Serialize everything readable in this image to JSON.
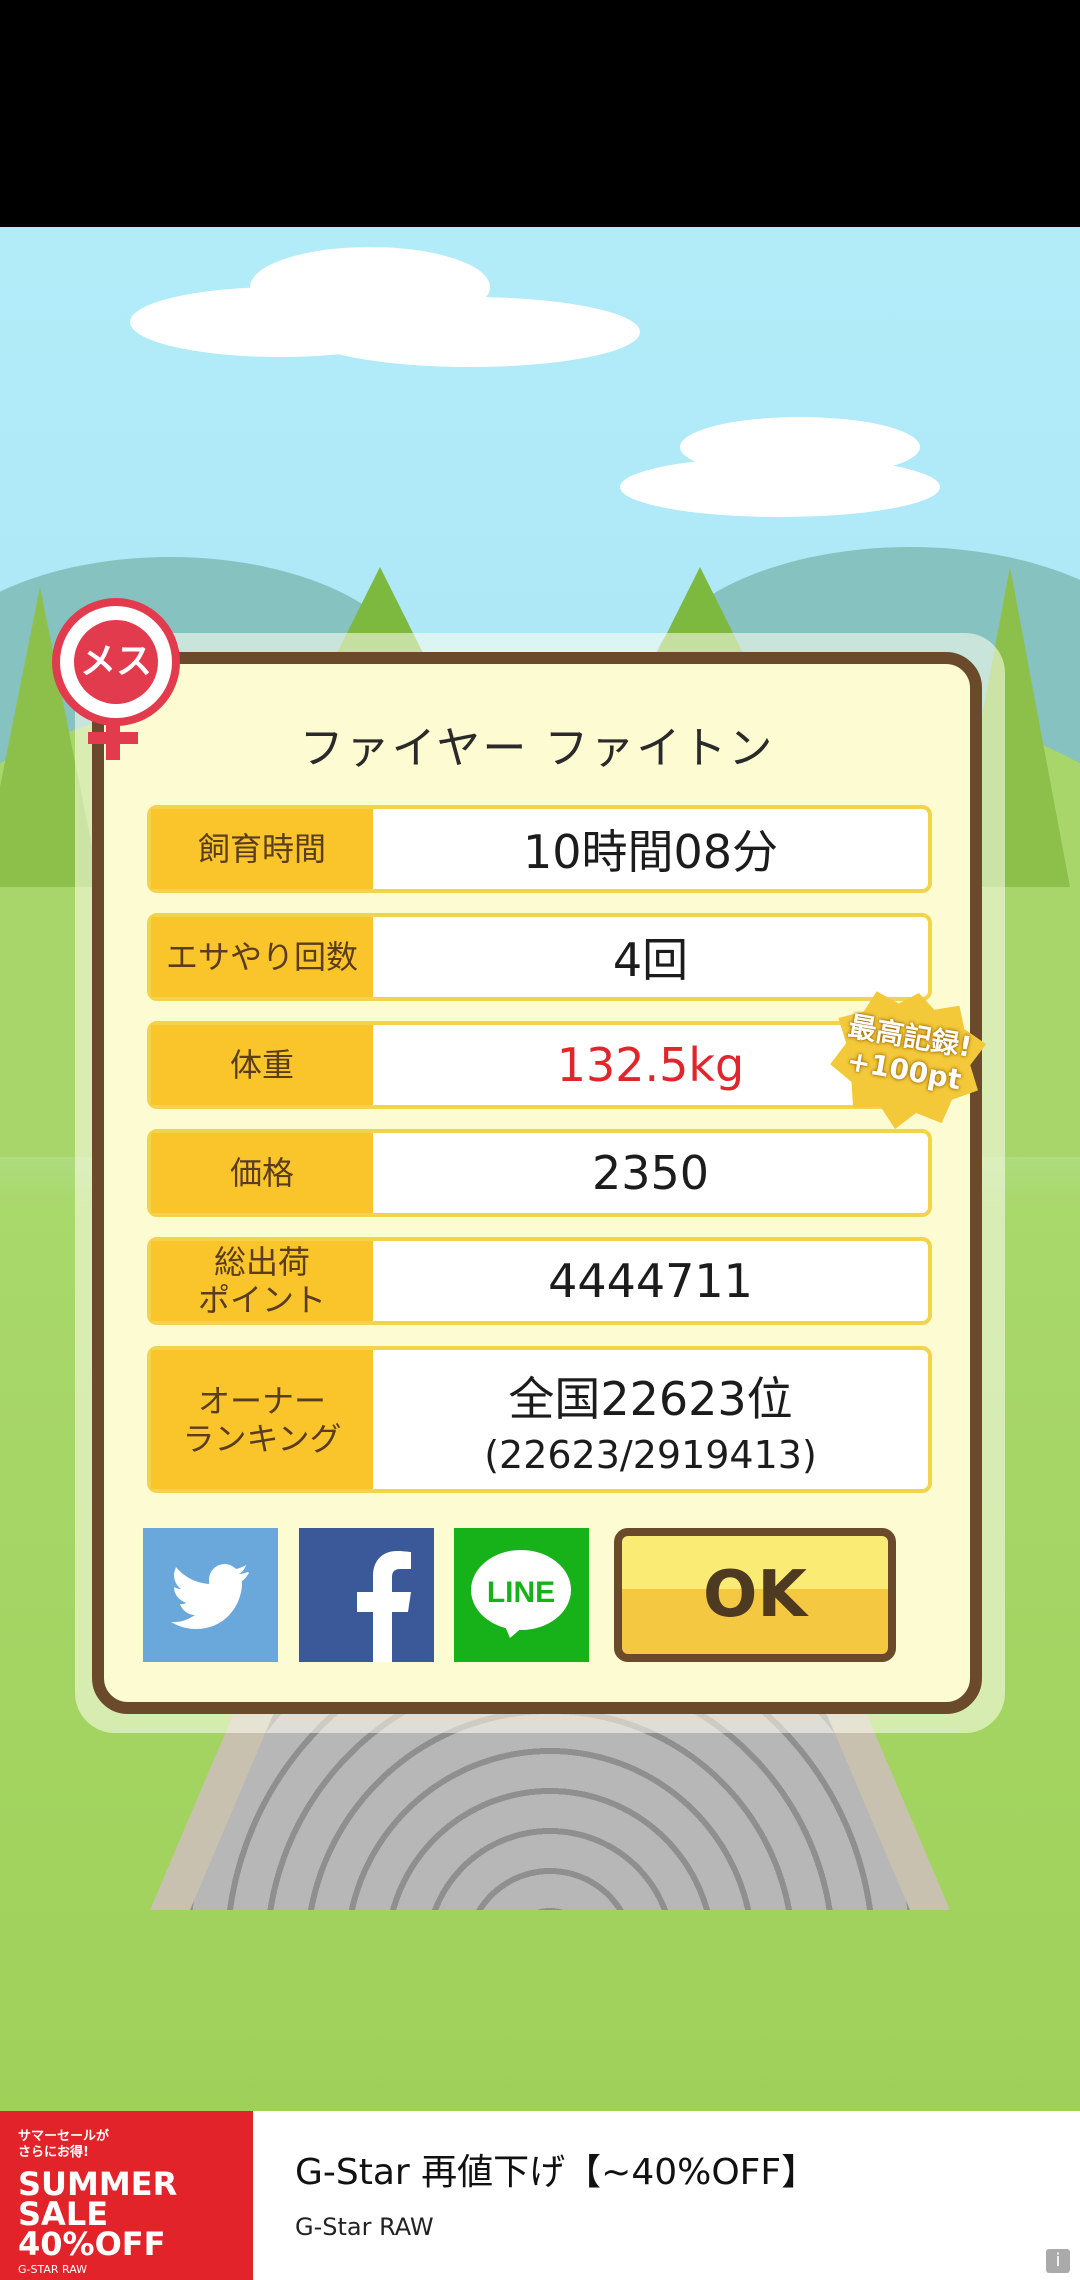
{
  "pet": {
    "gender_badge": "メス",
    "name": "ファイヤー ファイトン"
  },
  "stats": [
    {
      "label": "飼育時間",
      "value": "10時間08分"
    },
    {
      "label": "エサやり回数",
      "value": "4回"
    },
    {
      "label": "体重",
      "value": "132.5kg",
      "highlight": true
    },
    {
      "label": "価格",
      "value": "2350"
    },
    {
      "label": "総出荷\nポイント",
      "value": "4444711"
    },
    {
      "label": "オーナー\nランキング",
      "value": "全国22623位",
      "sub": "(22623/2919413)"
    }
  ],
  "record_badge": "最高記録!\n+100pt",
  "share": {
    "twitter_icon": "twitter-bird-icon",
    "facebook_icon": "facebook-f-icon",
    "line_label": "LINE"
  },
  "ok_label": "OK",
  "ad": {
    "image_line1": "サマーセールが\nさらにお得!",
    "image_line2": "SUMMER\nSALE\n40%OFF",
    "image_line3": "G-STAR RAW",
    "title": "G-Star 再値下げ【~40%OFF】",
    "advertiser": "G-Star RAW",
    "info_icon": "info-icon"
  },
  "colors": {
    "panel_border": "#6b4a2c",
    "label_bg": "#f9c52b",
    "highlight_text": "#e0262c",
    "badge_red": "#e23b4d"
  }
}
